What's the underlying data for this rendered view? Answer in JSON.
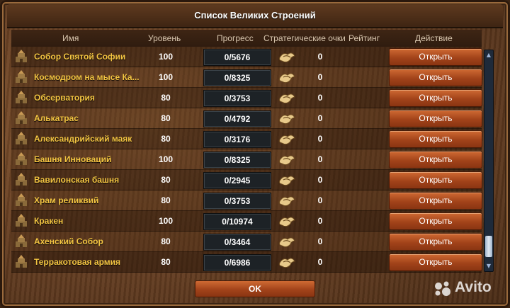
{
  "window": {
    "title": "Список Великих Строений"
  },
  "table": {
    "columns": [
      "Имя",
      "Уровень",
      "Прогресс",
      "Стратегические очки",
      "Рейтинг",
      "Действие"
    ],
    "rows": [
      {
        "icon": "building-icon",
        "name": "Собор Святой Софии",
        "level": "100",
        "progress": "0/5676",
        "sp": "0",
        "action": "Открыть"
      },
      {
        "icon": "building-icon",
        "name": "Космодром на мысе Ка...",
        "level": "100",
        "progress": "0/8325",
        "sp": "0",
        "action": "Открыть"
      },
      {
        "icon": "building-icon",
        "name": "Обсерватория",
        "level": "80",
        "progress": "0/3753",
        "sp": "0",
        "action": "Открыть"
      },
      {
        "icon": "building-icon",
        "name": "Алькатрас",
        "level": "80",
        "progress": "0/4792",
        "sp": "0",
        "action": "Открыть"
      },
      {
        "icon": "building-icon",
        "name": "Александрийский маяк",
        "level": "80",
        "progress": "0/3176",
        "sp": "0",
        "action": "Открыть"
      },
      {
        "icon": "building-icon",
        "name": "Башня Инноваций",
        "level": "100",
        "progress": "0/8325",
        "sp": "0",
        "action": "Открыть"
      },
      {
        "icon": "building-icon",
        "name": "Вавилонская башня",
        "level": "80",
        "progress": "0/2945",
        "sp": "0",
        "action": "Открыть"
      },
      {
        "icon": "building-icon",
        "name": "Храм реликвий",
        "level": "80",
        "progress": "0/3753",
        "sp": "0",
        "action": "Открыть"
      },
      {
        "icon": "building-icon",
        "name": "Кракен",
        "level": "100",
        "progress": "0/10974",
        "sp": "0",
        "action": "Открыть"
      },
      {
        "icon": "building-icon",
        "name": "Ахенский Собор",
        "level": "80",
        "progress": "0/3464",
        "sp": "0",
        "action": "Открыть"
      },
      {
        "icon": "building-icon",
        "name": "Терракотовая армия",
        "level": "80",
        "progress": "0/6986",
        "sp": "0",
        "action": "Открыть"
      }
    ]
  },
  "footer": {
    "ok_label": "OK"
  },
  "watermark": {
    "text": "Avito"
  },
  "colors": {
    "name_text": "#f4c542",
    "button": "#b3501f",
    "progress_bg": "#1d2226"
  }
}
